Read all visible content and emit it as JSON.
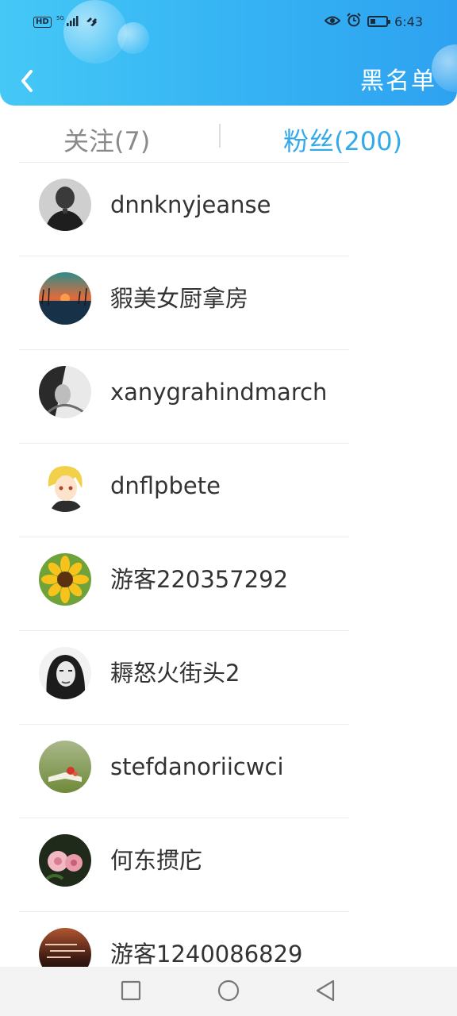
{
  "status_bar": {
    "hd_label": "HD",
    "network": "5G",
    "time": "6:43",
    "battery_level": 0.35,
    "icons": [
      "wifi-signal-icon",
      "nfc-icon",
      "eye-icon",
      "alarm-icon",
      "battery-icon"
    ]
  },
  "header": {
    "title": "黑名单",
    "back_icon": "chevron-left-icon",
    "gradient": [
      "#45c8f6",
      "#2ea2f0"
    ]
  },
  "tabs": {
    "following": "关注(7)",
    "followers": "粉丝(200)",
    "active": "followers",
    "active_color": "#34a9ea",
    "inactive_color": "#8a8a8a"
  },
  "users": [
    {
      "name": "dnnknyjeanse",
      "avatar": "man-portrait-photo"
    },
    {
      "name": "貑美女厨拿房",
      "avatar": "sunset-lake-photo"
    },
    {
      "name": "xanygrahindmarch",
      "avatar": "woman-monochrome-photo"
    },
    {
      "name": "dnflpbete",
      "avatar": "anime-boy-avatar"
    },
    {
      "name": "游客220357292",
      "avatar": "sunflower-photo"
    },
    {
      "name": "耨怒火街头2",
      "avatar": "woman-bw-portrait-photo"
    },
    {
      "name": "stefdanoriicwci",
      "avatar": "book-flower-photo"
    },
    {
      "name": "何东掼庀",
      "avatar": "pink-roses-photo"
    },
    {
      "name": "游客1240086829",
      "avatar": "dark-text-photo"
    }
  ],
  "nav": {
    "icons": [
      "recent-apps-icon",
      "home-icon",
      "back-icon"
    ]
  }
}
